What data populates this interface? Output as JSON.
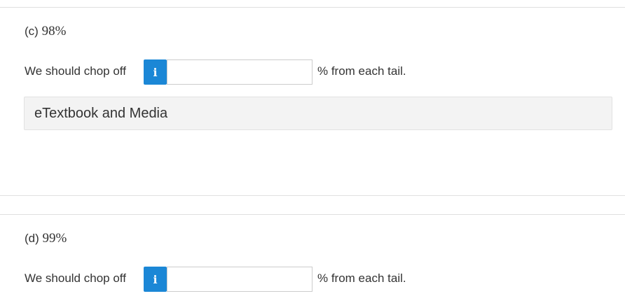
{
  "part_c": {
    "label_prefix": "(c)",
    "percent": "98%",
    "lead_text": "We should chop off",
    "info_icon": "info-icon",
    "input_value": "",
    "trail_text": "% from each tail."
  },
  "etextbook": {
    "label": "eTextbook and Media"
  },
  "part_d": {
    "label_prefix": "(d)",
    "percent": "99%",
    "lead_text": "We should chop off",
    "info_icon": "info-icon",
    "input_value": "",
    "trail_text": "% from each tail."
  },
  "colors": {
    "info_button": "#1b87d6",
    "media_bar_bg": "#f3f3f3",
    "divider": "#e0e0e0"
  }
}
